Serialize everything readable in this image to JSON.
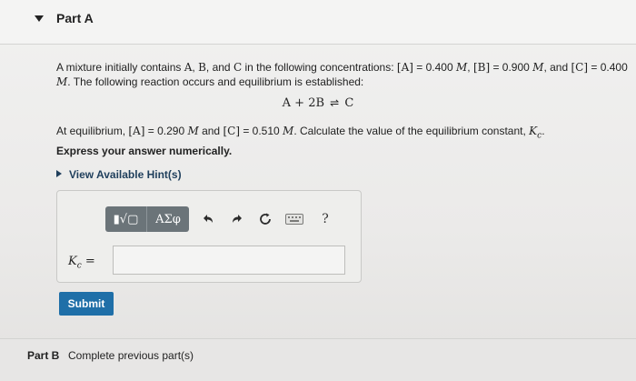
{
  "part_a": {
    "title": "Part A",
    "problem": {
      "t1": "A mixture initially contains ",
      "A": "A",
      "c1": ", ",
      "B": "B",
      "c2": ", and ",
      "C": "C",
      "t2": " in the following concentrations: ",
      "concA_lbl": "[A]",
      "concA_val": " = 0.400 ",
      "M1": "M",
      "c3": ", ",
      "concB_lbl": "[B]",
      "concB_val": " = 0.900 ",
      "M2": "M",
      "c4": ", and ",
      "concC_lbl": "[C]",
      "concC_val": " = 0.400",
      "M3": "M",
      "t3": ". The following reaction occurs and equilibrium is established:"
    },
    "reaction": {
      "left": "A + 2B",
      "arrow": "⇌",
      "right": "C"
    },
    "equilibrium": {
      "t1": "At equilibrium, ",
      "concA_lbl": "[A]",
      "concA_val": " = 0.290 ",
      "M1": "M",
      "t2": " and ",
      "concC_lbl": "[C]",
      "concC_val": " = 0.510 ",
      "M2": "M",
      "t3": ". Calculate the value of the equilibrium constant, ",
      "K": "K",
      "sub": "c",
      "t4": "."
    },
    "express": "Express your answer numerically.",
    "hint": "View Available Hint(s)",
    "toolbar": {
      "templates_label": "▮√▢",
      "greek_label": "ΑΣφ",
      "undo_icon": "undo-icon",
      "redo_icon": "redo-icon",
      "reset_icon": "reset-icon",
      "keyboard_icon": "keyboard-icon",
      "help_label": "?"
    },
    "answer_label": {
      "K": "K",
      "sub": "c",
      "eq": " ="
    },
    "answer_value": "",
    "submit": "Submit"
  },
  "part_b": {
    "title": "Part B",
    "status": "Complete previous part(s)"
  },
  "colors": {
    "submit_bg": "#1f6fa8",
    "toolbar_bg": "#6b7479",
    "hint_text": "#1f3f5c"
  }
}
